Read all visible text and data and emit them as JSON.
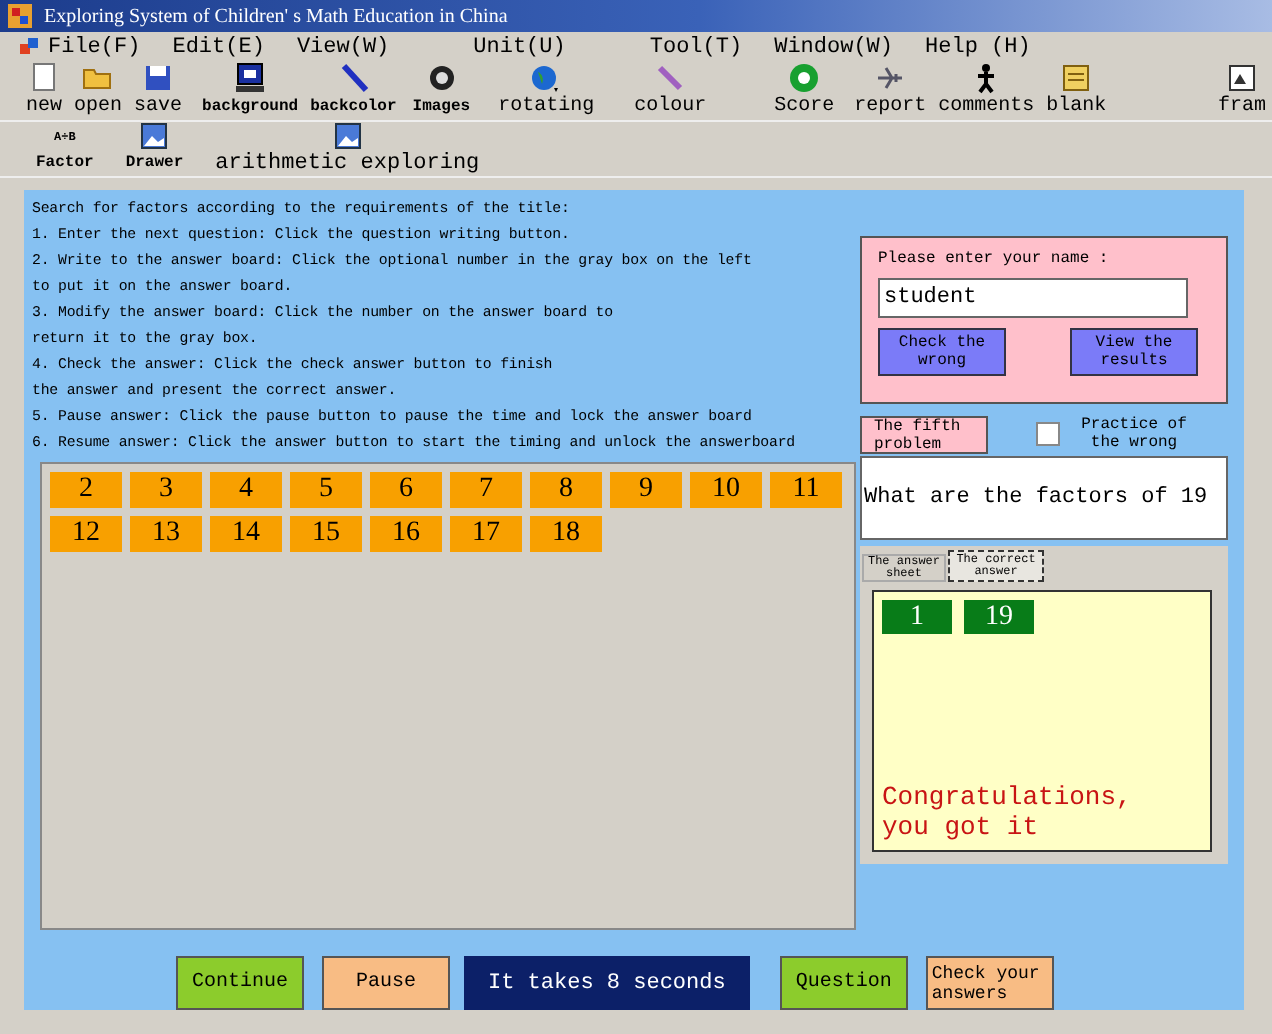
{
  "window": {
    "title": "Exploring System of Children' s Math Education in China"
  },
  "menu": [
    "File(F)",
    "Edit(E)",
    "View(W)",
    "Unit(U)",
    "Tool(T)",
    "Window(W)",
    "Help (H)"
  ],
  "toolbar": [
    {
      "label": "new"
    },
    {
      "label": "open"
    },
    {
      "label": "save"
    },
    {
      "label": "background"
    },
    {
      "label": "backcolor"
    },
    {
      "label": "Images"
    },
    {
      "label": "rotating"
    },
    {
      "label": "colour"
    },
    {
      "label": "Score"
    },
    {
      "label": "report"
    },
    {
      "label": "comments"
    },
    {
      "label": "blank"
    },
    {
      "label": "fram"
    }
  ],
  "toolbar_2": [
    {
      "label": "Factor",
      "icon_text": "A÷B"
    },
    {
      "label": "Drawer"
    },
    {
      "label": "arithmetic exploring"
    }
  ],
  "instructions": [
    "Search for factors according to the requirements of the title:",
    "1. Enter the next question: Click the question writing button.",
    "2. Write to the answer board: Click the optional number in the gray box on the left",
    "to put it on the answer board.",
    "3. Modify the answer board: Click the number on the answer board to",
    "return it to the gray box.",
    "4. Check the answer: Click the check answer button to finish",
    "the answer and present the correct answer.",
    "5. Pause answer: Click the pause button to pause the time and lock the answer board",
    "6. Resume answer: Click the answer button to start the timing and unlock the answerboard"
  ],
  "number_tiles": [
    "2",
    "3",
    "4",
    "5",
    "6",
    "7",
    "8",
    "9",
    "10",
    "11",
    "12",
    "13",
    "14",
    "15",
    "16",
    "17",
    "18"
  ],
  "name_panel": {
    "label": "Please enter your name :",
    "value": "student",
    "buttons": [
      "Check the wrong",
      "View the results"
    ]
  },
  "problem_label": "The fifth problem",
  "practice_wrong": {
    "label": "Practice of the wrong",
    "checked": false
  },
  "question": "What are the factors of 19",
  "answer_tabs": [
    {
      "label": "The answer sheet",
      "selected": false
    },
    {
      "label": "The correct answer",
      "selected": true
    }
  ],
  "answer_tiles": [
    "1",
    "19"
  ],
  "answer_message": "Congratulations, you got it",
  "bottom_controls": [
    {
      "kind": "button",
      "label": "Continue",
      "color": "#8ccc2c"
    },
    {
      "kind": "button",
      "label": "Pause",
      "color": "#f8bc84"
    },
    {
      "kind": "timer",
      "label": "It takes 8 seconds"
    },
    {
      "kind": "button",
      "label": "Question",
      "color": "#8ccc2c"
    },
    {
      "kind": "button",
      "label": "Check your answers",
      "color": "#f8bc84"
    }
  ]
}
